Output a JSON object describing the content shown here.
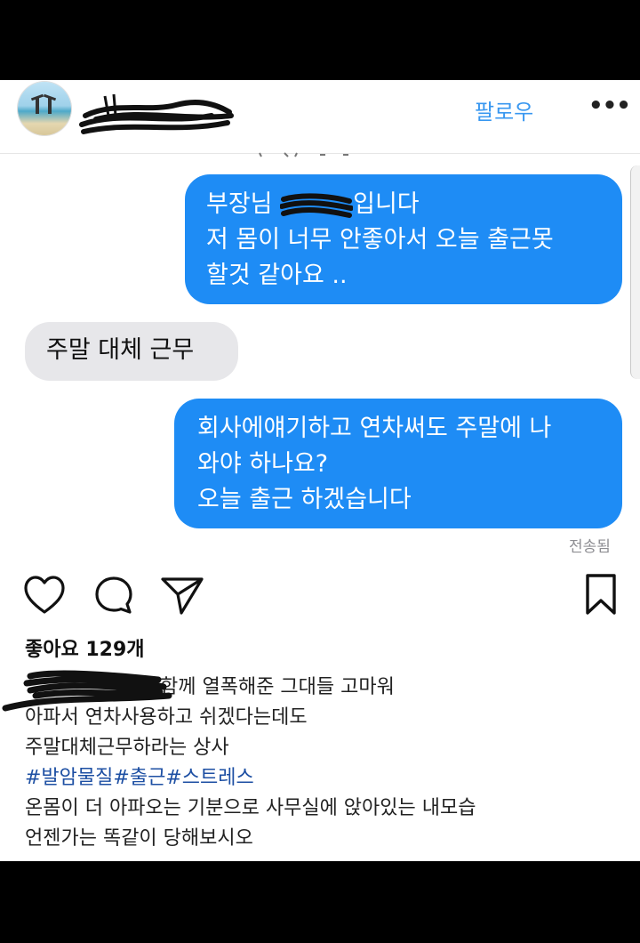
{
  "header": {
    "follow_label": "팔로우",
    "more_label": "•••"
  },
  "messages": {
    "out1": {
      "line1_prefix": "부장님",
      "line1_suffix": "입니다",
      "line2": "저 몸이 너무 안좋아서 오늘 출근못",
      "line3": "할것 같아요 .."
    },
    "in1": {
      "text": "주말 대체 근무"
    },
    "out2": {
      "line1": "회사에얘기하고 연차써도 주말에 나",
      "line2": "와야 하나요?",
      "line3": "오늘 출근 하겠습니다"
    },
    "status": "전송됨"
  },
  "actions": {
    "icons": [
      "heart-icon",
      "comment-icon",
      "share-icon",
      "bookmark-icon"
    ]
  },
  "likes": "좋아요 129개",
  "caption": {
    "line1_suffix": "함께 열폭해준 그대들 고마워",
    "line2": "아파서 연차사용하고 쉬겠다는데도",
    "line3": "주말대체근무하라는 상사",
    "hashtags": "#발암물질#출근#스트레스",
    "line5": "온몸이 더 아파오는 기분으로 사무실에 앉아있는 내모습",
    "line6": "언젠가는 똑같이 당해보시오"
  },
  "colors": {
    "outgoing_bubble": "#1e8cf5",
    "incoming_bubble": "#e7e7ea",
    "follow": "#3897f0",
    "hashtag": "#1d4fa3"
  }
}
